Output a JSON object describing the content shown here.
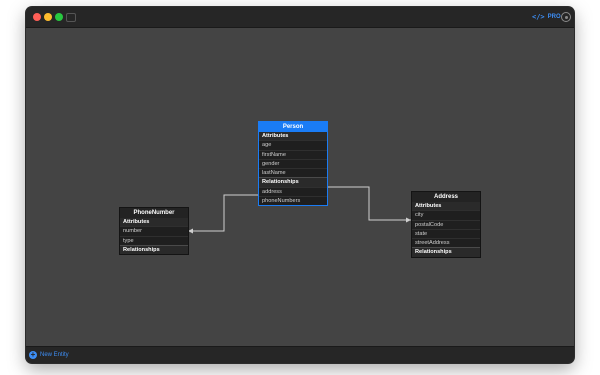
{
  "toolbar": {
    "code_glyph": "</>",
    "code_label": "PRO"
  },
  "entities": {
    "person": {
      "name": "Person",
      "attributes_header": "Attributes",
      "attributes": [
        "age",
        "firstName",
        "gender",
        "lastName"
      ],
      "relationships_header": "Relationships",
      "relationships": [
        "address",
        "phoneNumbers"
      ]
    },
    "phone": {
      "name": "PhoneNumber",
      "attributes_header": "Attributes",
      "attributes": [
        "number",
        "type"
      ],
      "relationships_header": "Relationships",
      "relationships": []
    },
    "address": {
      "name": "Address",
      "attributes_header": "Attributes",
      "attributes": [
        "city",
        "postalCode",
        "state",
        "streetAddress"
      ],
      "relationships_header": "Relationships",
      "relationships": []
    }
  },
  "bottom": {
    "new_entity_label": "New Entity"
  },
  "colors": {
    "accent": "#1a7cf5",
    "canvas": "#444444",
    "entity_body": "#1f1f1f"
  }
}
